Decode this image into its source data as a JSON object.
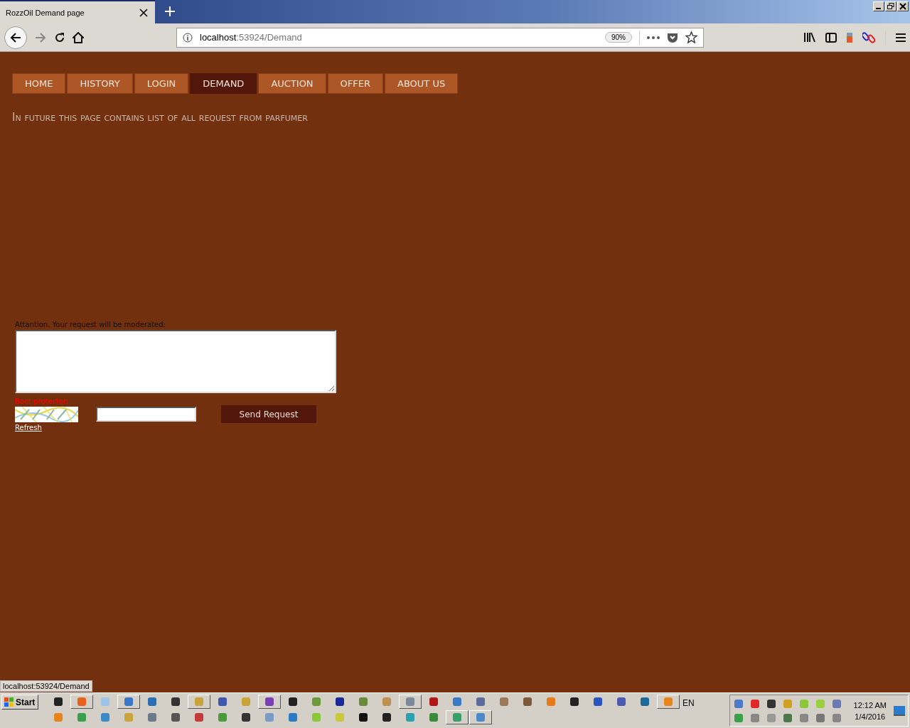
{
  "browser": {
    "tab_title": "RozzOil Demand page",
    "url_host": "localhost",
    "url_path": ":53924/Demand",
    "zoom": "90%"
  },
  "nav": [
    {
      "label": "HOME",
      "selected": false
    },
    {
      "label": "HISTORY",
      "selected": false
    },
    {
      "label": "LOGIN",
      "selected": false
    },
    {
      "label": "DEMAND",
      "selected": true
    },
    {
      "label": "AUCTION",
      "selected": false
    },
    {
      "label": "OFFER",
      "selected": false
    },
    {
      "label": "ABOUT US",
      "selected": false
    }
  ],
  "heading": "In future this page contains list of all request from parfumer",
  "form": {
    "attention": "Attantion. Your request will be moderated:",
    "captcha_label": "Boot protector:",
    "refresh": "Refresh",
    "submit": "Send Request"
  },
  "status_url": "localhost:53924/Demand",
  "taskbar": {
    "start": "Start",
    "language": "EN",
    "time": "12:12 AM",
    "date": "1/4/2016"
  }
}
